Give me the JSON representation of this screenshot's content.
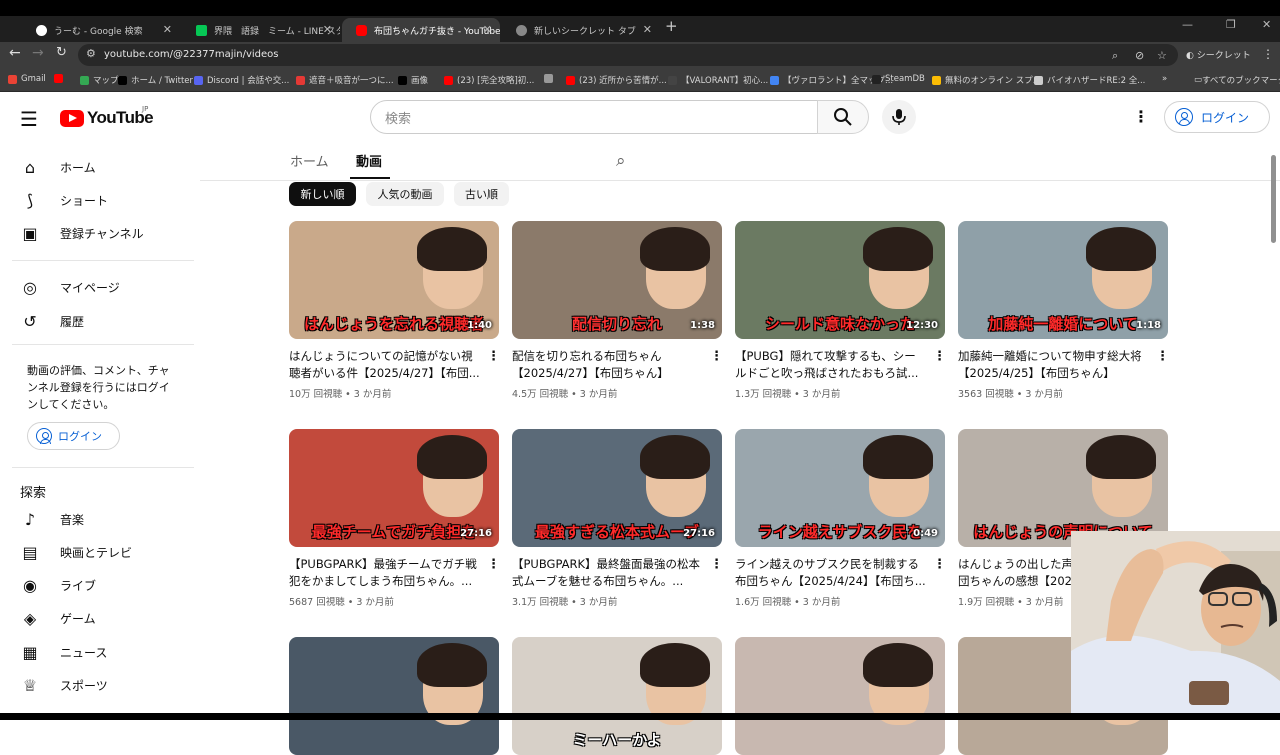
{
  "browser": {
    "tabs": [
      {
        "title": "うーむ - Google 検索",
        "color": "#ffffff"
      },
      {
        "title": "界隈　語録　ミーム - LINE スタン",
        "color": "#06c755"
      },
      {
        "title": "布団ちゃんガチ抜き - YouTube",
        "color": "#ff0000"
      },
      {
        "title": "新しいシークレット タブ",
        "color": "#888888"
      }
    ],
    "url": "youtube.com/@22377majin/videos",
    "incognito_label": "シークレット",
    "bookmarks": [
      {
        "label": "Gmail",
        "color": "#ea4335"
      },
      {
        "label": "",
        "color": "#ff0000"
      },
      {
        "label": "マップ",
        "color": "#34a853"
      },
      {
        "label": "ホーム / Twitter",
        "color": "#000000"
      },
      {
        "label": "Discord | 会話や交...",
        "color": "#5865f2"
      },
      {
        "label": "遮音＋吸音が一つに...",
        "color": "#e53935"
      },
      {
        "label": "画像",
        "color": "#000000"
      },
      {
        "label": "(23) [完全攻略]初...",
        "color": "#ff0000"
      },
      {
        "label": "",
        "color": "#999999"
      },
      {
        "label": "(23) 近所から苦情が...",
        "color": "#ff0000"
      },
      {
        "label": "【VALORANT】初心...",
        "color": "#444444"
      },
      {
        "label": "【ヴァロラント】全マップ...",
        "color": "#4285f4"
      },
      {
        "label": "SteamDB",
        "color": "#222222"
      },
      {
        "label": "無料のオンライン スプ...",
        "color": "#fbbc04"
      },
      {
        "label": "バイオハザードRE:2 全...",
        "color": "#cccccc"
      }
    ],
    "all_bookmarks": "すべてのブックマーク"
  },
  "header": {
    "logo_text": "YouTube",
    "region": "JP",
    "search_placeholder": "検索",
    "login": "ログイン"
  },
  "sidebar": {
    "main": [
      {
        "label": "ホーム",
        "icon": "home-icon",
        "glyph": "⌂"
      },
      {
        "label": "ショート",
        "icon": "shorts-icon",
        "glyph": "⟆"
      },
      {
        "label": "登録チャンネル",
        "icon": "subscriptions-icon",
        "glyph": "▣"
      }
    ],
    "you": [
      {
        "label": "マイページ",
        "icon": "account-icon",
        "glyph": "◎"
      },
      {
        "label": "履歴",
        "icon": "history-icon",
        "glyph": "↺"
      }
    ],
    "login_note": "動画の評価、コメント、チャンネル登録を行うにはログインしてください。",
    "login_button": "ログイン",
    "explore_title": "探索",
    "explore": [
      {
        "label": "音楽",
        "icon": "music-icon",
        "glyph": "♪"
      },
      {
        "label": "映画とテレビ",
        "icon": "movies-icon",
        "glyph": "▤"
      },
      {
        "label": "ライブ",
        "icon": "live-icon",
        "glyph": "◉"
      },
      {
        "label": "ゲーム",
        "icon": "gaming-icon",
        "glyph": "◈"
      },
      {
        "label": "ニュース",
        "icon": "news-icon",
        "glyph": "▦"
      },
      {
        "label": "スポーツ",
        "icon": "sports-icon",
        "glyph": "♕"
      }
    ]
  },
  "channel_tabs": [
    "ホーム",
    "動画"
  ],
  "filters": [
    "新しい順",
    "人気の動画",
    "古い順"
  ],
  "videos": [
    {
      "title": "はんじょうについての記憶がない視聴者がいる件【2025/4/27】【布団...",
      "views": "10万 回視聴",
      "age": "3 か月前",
      "duration": "1:40",
      "caption": "はんじょうを忘れる視聴者",
      "bg": "#c9a98a",
      "capcolor": "#ff2a2a"
    },
    {
      "title": "配信を切り忘れる布団ちゃん【2025/4/27】【布団ちゃん】",
      "views": "4.5万 回視聴",
      "age": "3 か月前",
      "duration": "1:38",
      "caption": "配信切り忘れ",
      "bg": "#8b7a6a",
      "capcolor": "#ff3030"
    },
    {
      "title": "【PUBG】隠れて攻撃するも、シールドごと吹っ飛ばされたおもろ試...",
      "views": "1.3万 回視聴",
      "age": "3 か月前",
      "duration": "12:30",
      "caption": "シールド意味なかった",
      "bg": "#6b7a62",
      "capcolor": "#ff2a2a"
    },
    {
      "title": "加藤純一離婚について物申す総大将【2025/4/25】【布団ちゃん】",
      "views": "3563 回視聴",
      "age": "3 か月前",
      "duration": "1:18",
      "caption": "加藤純一離婚について",
      "bg": "#8fa0a8",
      "capcolor": "#ff2a2a"
    },
    {
      "title": "【PUBGPARK】最強チームでガチ戦犯をかましてしまう布団ちゃん。...",
      "views": "5687 回視聴",
      "age": "3 か月前",
      "duration": "27:16",
      "caption": "最強チームでガチ負担を",
      "bg": "#c24a3c",
      "capcolor": "#ff2a2a"
    },
    {
      "title": "【PUBGPARK】最終盤面最強の松本式ムーブを魅せる布団ちゃん。...",
      "views": "3.1万 回視聴",
      "age": "3 か月前",
      "duration": "27:16",
      "caption": "最強すぎる松本式ムーブ",
      "bg": "#5b6a78",
      "capcolor": "#ff2a2a"
    },
    {
      "title": "ライン越えのサブスク民を制裁する布団ちゃん【2025/4/24】【布団ち...",
      "views": "1.6万 回視聴",
      "age": "3 か月前",
      "duration": "0:49",
      "caption": "ライン越えサブスク民を",
      "bg": "#9aa6ad",
      "capcolor": "#ff2a2a"
    },
    {
      "title": "はんじょうの出した声明について布団ちゃんの感想【2025/4/23】",
      "views": "1.9万 回視聴",
      "age": "3 か月前",
      "duration": "",
      "caption": "はんじょうの声明について",
      "bg": "#b8b0a8",
      "capcolor": "#ff2a2a"
    },
    {
      "title": "",
      "views": "",
      "age": "",
      "duration": "",
      "caption": "",
      "bg": "#4a5866",
      "capcolor": "#ff2a2a"
    },
    {
      "title": "",
      "views": "",
      "age": "",
      "duration": "",
      "caption": "ミーハーかよ",
      "bg": "#d7d0c8",
      "capcolor": "#ffffff"
    },
    {
      "title": "",
      "views": "",
      "age": "",
      "duration": "",
      "caption": "",
      "bg": "#c8b8b0",
      "capcolor": "#ff2a2a"
    },
    {
      "title": "",
      "views": "",
      "age": "",
      "duration": "",
      "caption": "",
      "bg": "#b8a898",
      "capcolor": "#ff2a2a"
    }
  ]
}
